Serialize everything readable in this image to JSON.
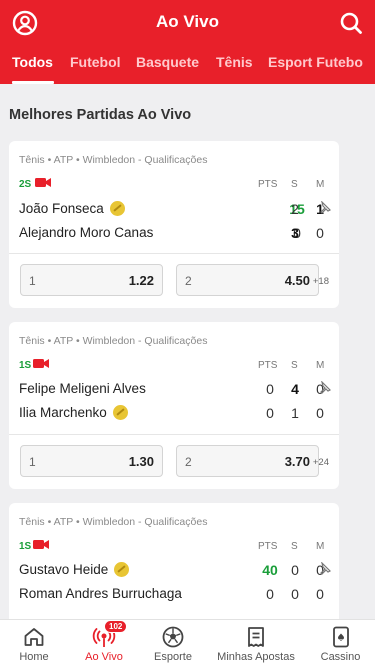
{
  "header": {
    "title": "Ao Vivo",
    "left_icon": "user-circle-icon",
    "right_icon": "search-icon",
    "tabs": [
      {
        "label": "Todos",
        "active": true
      },
      {
        "label": "Futebol",
        "active": false
      },
      {
        "label": "Basquete",
        "active": false
      },
      {
        "label": "Tênis",
        "active": false
      },
      {
        "label": "Esport Futebo",
        "active": false
      }
    ]
  },
  "section_title": "Melhores Partidas Ao Vivo",
  "score_headers": {
    "pts": "PTS",
    "s": "S",
    "m": "M"
  },
  "matches": [
    {
      "competition": "Tênis • ATP • Wimbledon - Qualificações",
      "status": "2S",
      "players": [
        {
          "name": "João Fonseca",
          "serving": true,
          "pts": "15",
          "s": "2",
          "m": "1"
        },
        {
          "name": "Alejandro Moro Canas",
          "serving": false,
          "pts": "0",
          "s": "3",
          "m": "0"
        }
      ],
      "odds": [
        {
          "label": "1",
          "value": "1.22"
        },
        {
          "label": "2",
          "value": "4.50"
        }
      ],
      "more_markets": "+18"
    },
    {
      "competition": "Tênis • ATP • Wimbledon - Qualificações",
      "status": "1S",
      "players": [
        {
          "name": "Felipe Meligeni Alves",
          "serving": false,
          "pts": "0",
          "s": "4",
          "m": "0"
        },
        {
          "name": "Ilia Marchenko",
          "serving": true,
          "pts": "0",
          "s": "1",
          "m": "0"
        }
      ],
      "odds": [
        {
          "label": "1",
          "value": "1.30"
        },
        {
          "label": "2",
          "value": "3.70"
        }
      ],
      "more_markets": "+24"
    },
    {
      "competition": "Tênis • ATP • Wimbledon - Qualificações",
      "status": "1S",
      "players": [
        {
          "name": "Gustavo Heide",
          "serving": true,
          "pts": "40",
          "s": "0",
          "m": "0"
        },
        {
          "name": "Roman Andres Burruchaga",
          "serving": false,
          "pts": "0",
          "s": "0",
          "m": "0"
        }
      ]
    }
  ],
  "bottom_nav": [
    {
      "label": "Home",
      "icon": "home-icon"
    },
    {
      "label": "Ao Vivo",
      "icon": "live-broadcast-icon",
      "active": true,
      "badge": "102"
    },
    {
      "label": "Esporte",
      "icon": "soccer-ball-icon"
    },
    {
      "label": "Minhas Apostas",
      "icon": "bet-slip-icon"
    },
    {
      "label": "Cassino",
      "icon": "playing-card-icon"
    }
  ],
  "colors": {
    "brand": "#e8202a",
    "live_green": "#1a9e3a",
    "background": "#efeff1"
  }
}
